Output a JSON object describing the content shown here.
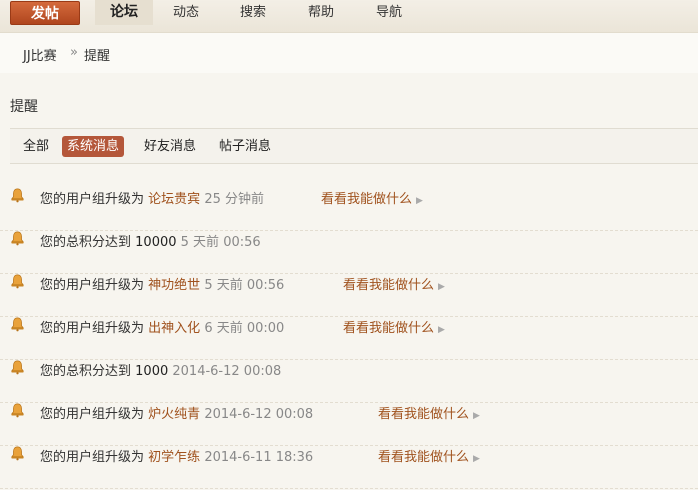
{
  "nav": {
    "post_label": "发帖",
    "items": [
      {
        "label": "论坛",
        "active": true
      },
      {
        "label": "动态"
      },
      {
        "label": "搜索"
      },
      {
        "label": "帮助"
      },
      {
        "label": "导航"
      }
    ]
  },
  "breadcrumb": {
    "home": "JJ比赛",
    "separator": "»",
    "current": "提醒"
  },
  "page_title": "提醒",
  "tabs": [
    {
      "label": "全部"
    },
    {
      "label": "系统消息",
      "active": true
    },
    {
      "label": "好友消息"
    },
    {
      "label": "帖子消息"
    }
  ],
  "notices": [
    {
      "text": "您的用户组升级为",
      "group": "论坛贵宾",
      "time": "25 分钟前",
      "more": "看看我能做什么"
    },
    {
      "text": "您的总积分达到",
      "value": "10000",
      "time": "5 天前 00:56"
    },
    {
      "text": "您的用户组升级为",
      "group": "神功绝世",
      "time": "5 天前 00:56",
      "more": "看看我能做什么"
    },
    {
      "text": "您的用户组升级为",
      "group": "出神入化",
      "time": "6 天前 00:00",
      "more": "看看我能做什么"
    },
    {
      "text": "您的总积分达到",
      "value": "1000",
      "time": "2014-6-12 00:08"
    },
    {
      "text": "您的用户组升级为",
      "group": "炉火纯青",
      "time": "2014-6-12 00:08",
      "more": "看看我能做什么"
    },
    {
      "text": "您的用户组升级为",
      "group": "初学乍练",
      "time": "2014-6-11 18:36",
      "more": "看看我能做什么"
    }
  ],
  "colors": {
    "accent": "#b4573a",
    "link": "#a0521e",
    "post_button": "#c2572d"
  },
  "icons": {
    "notice": "bell-icon",
    "more": "triangle-right-icon"
  }
}
